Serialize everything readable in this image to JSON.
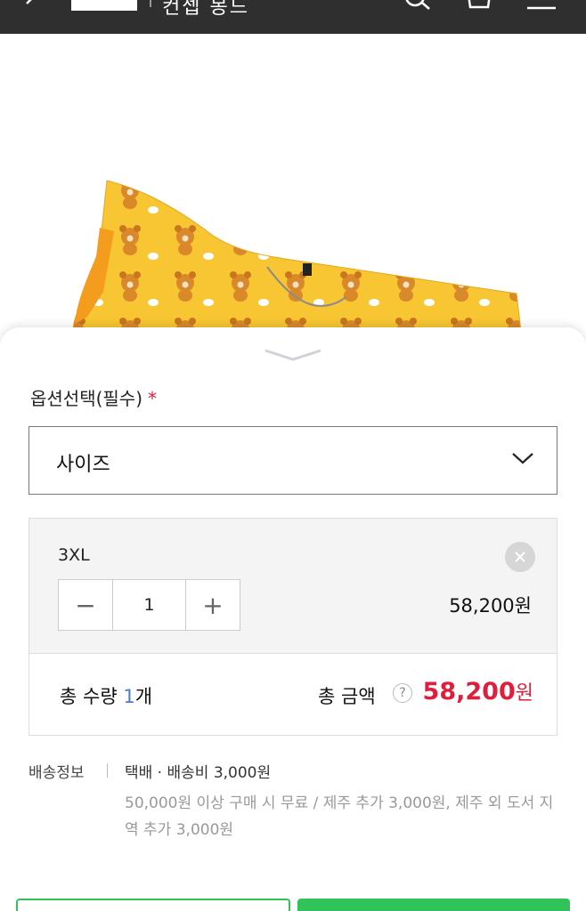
{
  "header": {
    "brand_text": "컨셉 몽드",
    "icons": [
      "back-arrow-icon",
      "search-icon",
      "cart-icon",
      "menu-icon"
    ]
  },
  "option": {
    "label": "옵션선택(필수)",
    "required_mark": "*",
    "select_value": "사이즈"
  },
  "selected_item": {
    "name": "3XL",
    "minus": "−",
    "quantity": "1",
    "plus": "+",
    "price": "58,200원"
  },
  "totals": {
    "qty_label": "총 수량",
    "qty_value": "1",
    "qty_unit": "개",
    "amount_label": "총 금액",
    "help": "?",
    "amount_value": "58,200",
    "amount_unit": "원"
  },
  "shipping": {
    "label": "배송정보",
    "method": "택배 · 배송비 3,000원",
    "detail": "50,000원 이상 구매 시 무료 / 제주 추가 3,000원, 제주 외 도서 지역 추가 3,000원"
  },
  "colors": {
    "accent_red": "#e01d3a",
    "qty_blue": "#4a7fc8",
    "button_green": "#2fc35a",
    "header_bg": "#2f2f2f"
  }
}
